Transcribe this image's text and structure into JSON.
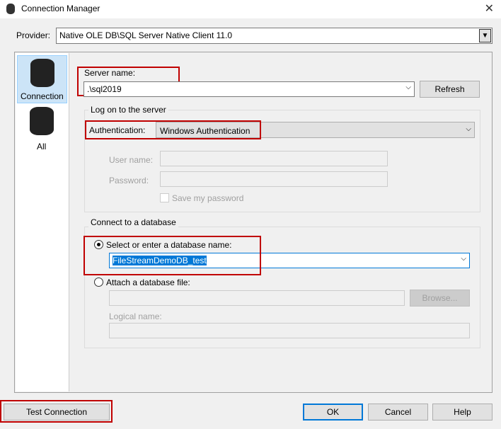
{
  "window": {
    "title": "Connection Manager",
    "close": "✕"
  },
  "provider": {
    "label": "Provider:",
    "value": "Native OLE DB\\SQL Server Native Client 11.0"
  },
  "sidebar": {
    "items": [
      {
        "label": "Connection"
      },
      {
        "label": "All"
      }
    ]
  },
  "server": {
    "label": "Server name:",
    "value": ".\\sql2019",
    "refresh": "Refresh"
  },
  "logon": {
    "title": "Log on to the server",
    "auth_label": "Authentication:",
    "auth_value": "Windows Authentication",
    "user_label": "User name:",
    "password_label": "Password:",
    "save_password": "Save my password"
  },
  "database": {
    "title": "Connect to a database",
    "select_label": "Select or enter a database name:",
    "db_value": "FileStreamDemoDB_test",
    "attach_label": "Attach a database file:",
    "browse": "Browse...",
    "logical_label": "Logical name:"
  },
  "footer": {
    "test": "Test Connection",
    "ok": "OK",
    "cancel": "Cancel",
    "help": "Help"
  }
}
